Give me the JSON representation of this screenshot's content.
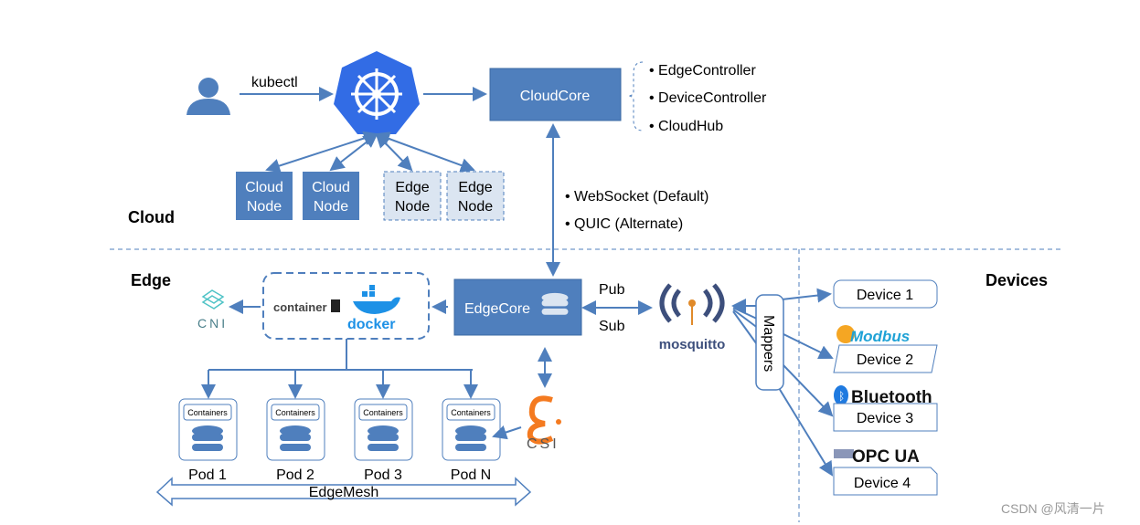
{
  "cloud": {
    "label": "Cloud",
    "kubectl": "kubectl",
    "cloudcore": "CloudCore",
    "components": [
      "• EdgeController",
      "• DeviceController",
      "• CloudHub"
    ],
    "nodes": [
      [
        "Cloud",
        "Node"
      ],
      [
        "Cloud",
        "Node"
      ],
      [
        "Edge",
        "Node"
      ],
      [
        "Edge",
        "Node"
      ]
    ],
    "protocols": [
      "• WebSocket (Default)",
      "• QUIC (Alternate)"
    ]
  },
  "edge": {
    "label": "Edge",
    "edgecore": "EdgeCore",
    "pub": "Pub",
    "sub": "Sub",
    "cni": "CNI",
    "containerd": "container",
    "docker": "docker",
    "containers_label": "Containers",
    "pods": [
      "Pod 1",
      "Pod 2",
      "Pod 3",
      "Pod N"
    ],
    "csi": "CSI",
    "edgemesh": "EdgeMesh",
    "mosquitto": "mosquitto",
    "mappers": "Mappers"
  },
  "devices": {
    "label": "Devices",
    "items": [
      "Device 1",
      "Device 2",
      "Device 3",
      "Device 4"
    ],
    "logos": [
      "Modbus",
      "Bluetooth",
      "OPC UA"
    ]
  },
  "watermark": "CSDN @风清一片",
  "colors": {
    "primary": "#4f7fbd",
    "k8s": "#326ce5",
    "edge_node_fill": "#dbe5f1"
  }
}
